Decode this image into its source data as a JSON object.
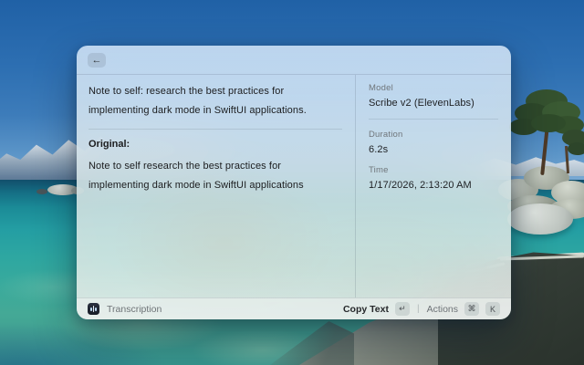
{
  "window": {
    "header": {
      "back_icon_glyph": "←"
    },
    "main": {
      "note_text": "Note to self: research the best practices for implementing dark mode in SwiftUI applications.",
      "original_label": "Original:",
      "original_text": "Note to self research the best practices for implementing dark mode in SwiftUI applications"
    },
    "sidebar": {
      "fields": [
        {
          "label": "Model",
          "value": "Scribe v2 (ElevenLabs)"
        },
        {
          "label": "Duration",
          "value": "6.2s"
        },
        {
          "label": "Time",
          "value": "1/17/2026, 2:13:20 AM"
        }
      ]
    },
    "footer": {
      "app_label": "Transcription",
      "copy_text_label": "Copy Text",
      "copy_key": "↵",
      "separator": "|",
      "actions_label": "Actions",
      "actions_keys": [
        "⌘",
        "K"
      ]
    }
  },
  "colors": {
    "sky_blue": "#2d6fb2",
    "water_teal": "#2ea7a1",
    "granite_light": "#b5bab2",
    "rock_dark": "#333d37",
    "window_tint": "#dde7ec"
  }
}
